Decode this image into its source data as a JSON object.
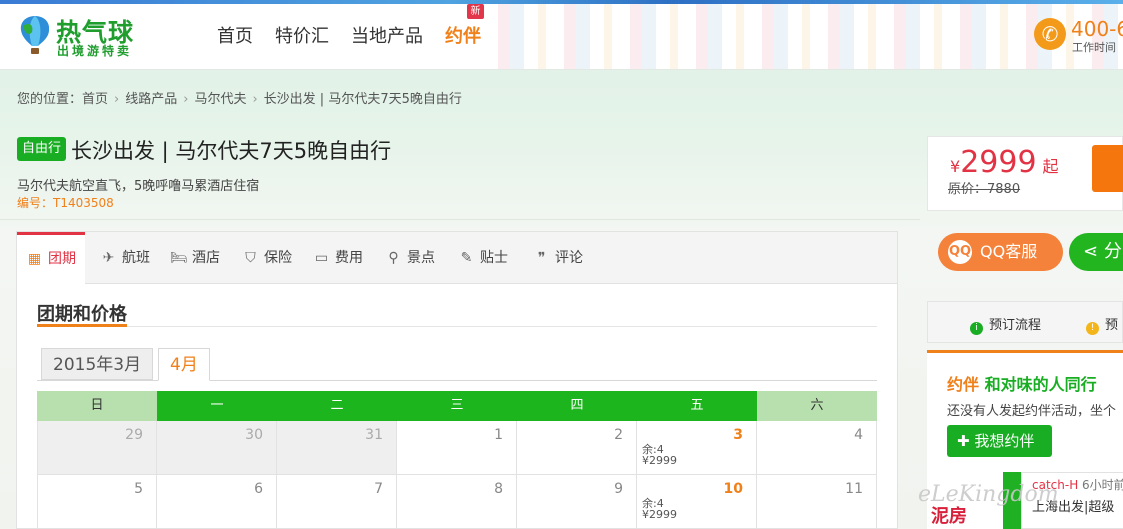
{
  "header": {
    "logo_text": "热气球",
    "logo_sub": "出境游特卖",
    "nav": [
      "首页",
      "特价汇",
      "当地产品",
      "约伴"
    ],
    "new_badge": "新",
    "phone": "400-6",
    "work_time": "工作时间"
  },
  "breadcrumb": {
    "prefix": "您的位置：",
    "items": [
      "首页",
      "线路产品",
      "马尔代夫",
      "长沙出发 | 马尔代夫7天5晚自由行"
    ],
    "separator": "›"
  },
  "product": {
    "tag": "自由行",
    "title": "长沙出发 | 马尔代夫7天5晚自由行",
    "subtitle": "马尔代夫航空直飞，5晚呼噜马累酒店住宿",
    "code": "编号：T1403508"
  },
  "price": {
    "currency": "¥",
    "value": "2999",
    "suffix": "起",
    "orig_label": "原价：",
    "orig_value": "7880"
  },
  "buttons": {
    "qq": "QQ客服",
    "qq_icon": "QQ",
    "share": "分"
  },
  "steps": {
    "step1": "预订流程",
    "step2": "预"
  },
  "companion": {
    "title_yue": "约伴",
    "title_rest": "和对味的人同行",
    "desc": "还没有人发起约伴活动，坐个",
    "want": "我想约伴",
    "feed_user": "catch-H",
    "feed_time": "6小时前",
    "feed_text": "上海出发|超级"
  },
  "poster_text": "泥房",
  "watermark": "eLeKingdom",
  "tabs": [
    {
      "icon": "calendar-icon",
      "glyph": "▦",
      "label": "团期"
    },
    {
      "icon": "plane-icon",
      "glyph": "✈",
      "label": "航班"
    },
    {
      "icon": "bed-icon",
      "glyph": "🛏",
      "label": "酒店"
    },
    {
      "icon": "shield-icon",
      "glyph": "⛉",
      "label": "保险"
    },
    {
      "icon": "wallet-icon",
      "glyph": "▭",
      "label": "费用"
    },
    {
      "icon": "location-pin-icon",
      "glyph": "⚲",
      "label": "景点"
    },
    {
      "icon": "tip-icon",
      "glyph": "✎",
      "label": "贴士"
    },
    {
      "icon": "comment-icon",
      "glyph": "❞",
      "label": "评论"
    }
  ],
  "section": {
    "title": "团期和价格",
    "months": [
      "2015年3月",
      "4月"
    ]
  },
  "calendar": {
    "weekdays": [
      "日",
      "一",
      "二",
      "三",
      "四",
      "五",
      "六"
    ],
    "rows": [
      [
        {
          "d": "29",
          "prev": true
        },
        {
          "d": "30",
          "prev": true
        },
        {
          "d": "31",
          "prev": true
        },
        {
          "d": "1"
        },
        {
          "d": "2"
        },
        {
          "d": "3",
          "rem": "余:4",
          "price": "¥2999"
        },
        {
          "d": "4"
        }
      ],
      [
        {
          "d": "5"
        },
        {
          "d": "6"
        },
        {
          "d": "7"
        },
        {
          "d": "8"
        },
        {
          "d": "9"
        },
        {
          "d": "10",
          "rem": "余:4",
          "price": "¥2999"
        },
        {
          "d": "11"
        }
      ]
    ]
  },
  "colors": {
    "green": "#19ad23",
    "orange": "#f0801a",
    "red": "#e23345"
  }
}
